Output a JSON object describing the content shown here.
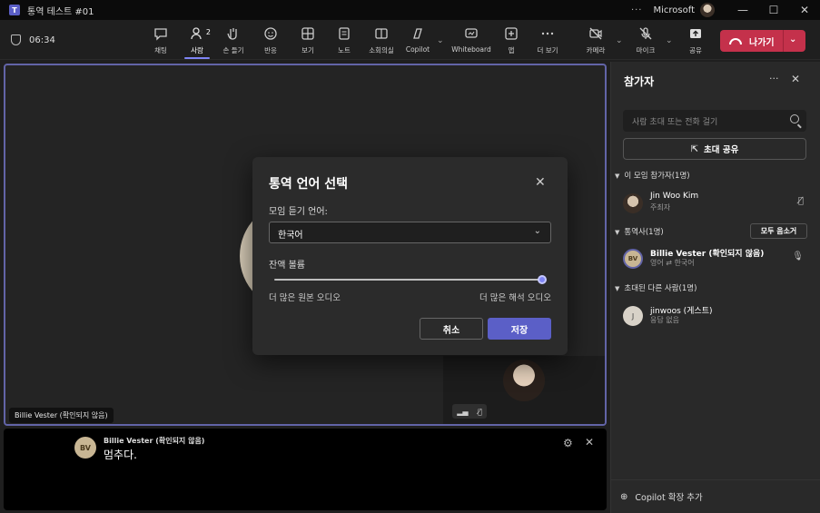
{
  "window": {
    "title": "통역 테스트 #01",
    "account": "Microsoft",
    "more": "···",
    "min": "—",
    "max": "☐",
    "close": "✕"
  },
  "meeting": {
    "timer": "06:34"
  },
  "toolbar": {
    "items": [
      {
        "label": "채팅",
        "icon": "chat-icon"
      },
      {
        "label": "사람",
        "icon": "people-icon",
        "badge": "2",
        "active": true
      },
      {
        "label": "손 들기",
        "icon": "raise-hand-icon"
      },
      {
        "label": "반응",
        "icon": "reaction-icon"
      },
      {
        "label": "보기",
        "icon": "view-icon"
      },
      {
        "label": "노트",
        "icon": "notes-icon"
      },
      {
        "label": "소회의실",
        "icon": "breakout-rooms-icon"
      },
      {
        "label": "Copilot",
        "icon": "copilot-icon"
      },
      {
        "label": "Whiteboard",
        "icon": "whiteboard-icon"
      },
      {
        "label": "앱",
        "icon": "apps-icon"
      },
      {
        "label": "더 보기",
        "icon": "more-icon"
      },
      {
        "label": "카메라",
        "icon": "camera-off-icon"
      },
      {
        "label": "마이크",
        "icon": "mic-off-icon"
      },
      {
        "label": "공유",
        "icon": "share-icon"
      }
    ],
    "leave_label": "나가기"
  },
  "stage": {
    "speaker_name": "Billie Vester (확인되지 않음)"
  },
  "caption": {
    "initials": "BV",
    "speaker": "Billie Vester (확인되지 않음)",
    "text": "멈추다."
  },
  "panel": {
    "title": "참가자",
    "search_placeholder": "사람 초대 또는 전화 걸기",
    "share_invite": "초대 공유",
    "sections": {
      "in_meeting": "이 모임 참가자(1명)",
      "interpreters": "통역사(1명)",
      "invited": "초대된 다른 사람(1명)"
    },
    "mute_all": "모두 음소거",
    "people": [
      {
        "name": "Jin Woo Kim",
        "role": "주최자"
      },
      {
        "name": "Billie Vester (확인되지 않음)",
        "role": "영어 ⇄ 한국어",
        "initials": "BV"
      },
      {
        "name": "jinwoos (게스트)",
        "role": "응답 없음",
        "initials": "J"
      }
    ],
    "copilot_ext": "Copilot 확장 추가"
  },
  "dialog": {
    "title": "통역 언어 선택",
    "language_label": "모임 듣기 언어:",
    "language_value": "한국어",
    "volume_label": "잔액 볼륨",
    "balance_value": 1.0,
    "left_hint": "더 많은 원본 오디오",
    "right_hint": "더 많은 해석 오디오",
    "cancel": "취소",
    "save": "저장"
  },
  "colors": {
    "accent": "#5b5fc7",
    "leave": "#c4314b",
    "stage_border": "#6264a7"
  }
}
